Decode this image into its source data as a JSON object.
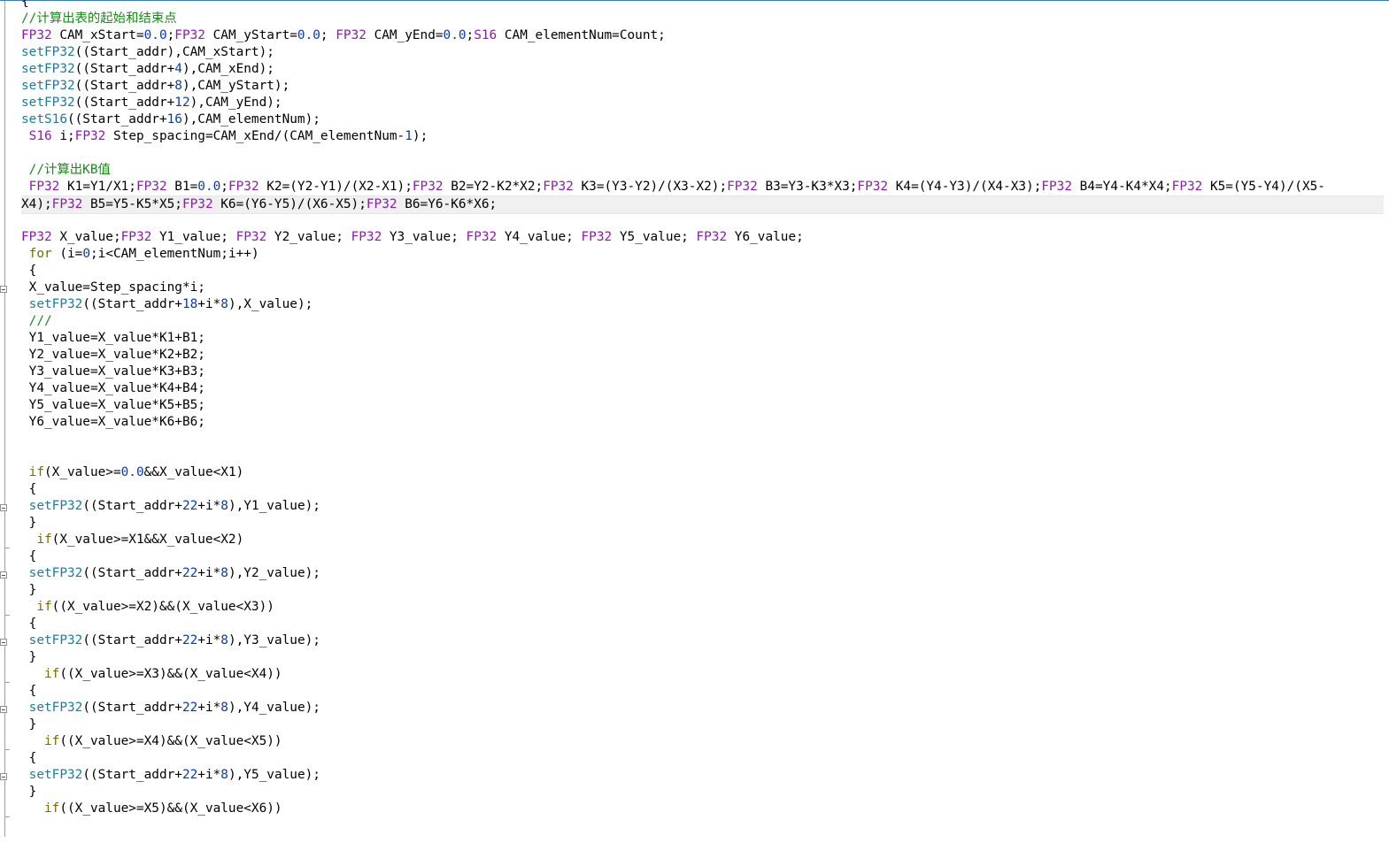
{
  "colors": {
    "type_keyword": "#8a1ea8",
    "function": "#1f7a9c",
    "number": "#0b3aa8",
    "comment": "#1a8a1a",
    "control": "#7a6a00",
    "text": "#000000",
    "current_line": "#f0f0f0"
  },
  "code_lines": [
    {
      "tokens": [
        {
          "t": "plain",
          "v": "{"
        }
      ]
    },
    {
      "tokens": [
        {
          "t": "cm",
          "v": "//计算出表的起始和结束点"
        }
      ]
    },
    {
      "tokens": [
        {
          "t": "kw",
          "v": "FP32"
        },
        {
          "t": "plain",
          "v": " CAM_xStart="
        },
        {
          "t": "num",
          "v": "0.0"
        },
        {
          "t": "plain",
          "v": ";"
        },
        {
          "t": "kw",
          "v": "FP32"
        },
        {
          "t": "plain",
          "v": " CAM_yStart="
        },
        {
          "t": "num",
          "v": "0.0"
        },
        {
          "t": "plain",
          "v": "; "
        },
        {
          "t": "kw",
          "v": "FP32"
        },
        {
          "t": "plain",
          "v": " CAM_yEnd="
        },
        {
          "t": "num",
          "v": "0.0"
        },
        {
          "t": "plain",
          "v": ";"
        },
        {
          "t": "kw",
          "v": "S16"
        },
        {
          "t": "plain",
          "v": " CAM_elementNum=Count;"
        }
      ]
    },
    {
      "tokens": [
        {
          "t": "fn",
          "v": "setFP32"
        },
        {
          "t": "plain",
          "v": "((Start_addr),CAM_xStart);"
        }
      ]
    },
    {
      "tokens": [
        {
          "t": "fn",
          "v": "setFP32"
        },
        {
          "t": "plain",
          "v": "((Start_addr+"
        },
        {
          "t": "num",
          "v": "4"
        },
        {
          "t": "plain",
          "v": "),CAM_xEnd);"
        }
      ]
    },
    {
      "tokens": [
        {
          "t": "fn",
          "v": "setFP32"
        },
        {
          "t": "plain",
          "v": "((Start_addr+"
        },
        {
          "t": "num",
          "v": "8"
        },
        {
          "t": "plain",
          "v": "),CAM_yStart);"
        }
      ]
    },
    {
      "tokens": [
        {
          "t": "fn",
          "v": "setFP32"
        },
        {
          "t": "plain",
          "v": "((Start_addr+"
        },
        {
          "t": "num",
          "v": "12"
        },
        {
          "t": "plain",
          "v": "),CAM_yEnd);"
        }
      ]
    },
    {
      "tokens": [
        {
          "t": "fn",
          "v": "setS16"
        },
        {
          "t": "plain",
          "v": "((Start_addr+"
        },
        {
          "t": "num",
          "v": "16"
        },
        {
          "t": "plain",
          "v": "),CAM_elementNum);"
        }
      ]
    },
    {
      "tokens": [
        {
          "t": "plain",
          "v": " "
        },
        {
          "t": "kw",
          "v": "S16"
        },
        {
          "t": "plain",
          "v": " i;"
        },
        {
          "t": "kw",
          "v": "FP32"
        },
        {
          "t": "plain",
          "v": " Step_spacing=CAM_xEnd/(CAM_elementNum-"
        },
        {
          "t": "num",
          "v": "1"
        },
        {
          "t": "plain",
          "v": ");"
        }
      ]
    },
    {
      "tokens": []
    },
    {
      "tokens": [
        {
          "t": "plain",
          "v": " "
        },
        {
          "t": "cm",
          "v": "//计算出KB值"
        }
      ]
    },
    {
      "tokens": [
        {
          "t": "plain",
          "v": " "
        },
        {
          "t": "kw",
          "v": "FP32"
        },
        {
          "t": "plain",
          "v": " K1=Y1/X1;"
        },
        {
          "t": "kw",
          "v": "FP32"
        },
        {
          "t": "plain",
          "v": " B1="
        },
        {
          "t": "num",
          "v": "0.0"
        },
        {
          "t": "plain",
          "v": ";"
        },
        {
          "t": "kw",
          "v": "FP32"
        },
        {
          "t": "plain",
          "v": " K2=(Y2-Y1)/(X2-X1);"
        },
        {
          "t": "kw",
          "v": "FP32"
        },
        {
          "t": "plain",
          "v": " B2=Y2-K2*X2;"
        },
        {
          "t": "kw",
          "v": "FP32"
        },
        {
          "t": "plain",
          "v": " K3=(Y3-Y2)/(X3-X2);"
        },
        {
          "t": "kw",
          "v": "FP32"
        },
        {
          "t": "plain",
          "v": " B3=Y3-K3*X3;"
        },
        {
          "t": "kw",
          "v": "FP32"
        },
        {
          "t": "plain",
          "v": " K4=(Y4-Y3)/(X4-X3);"
        },
        {
          "t": "kw",
          "v": "FP32"
        },
        {
          "t": "plain",
          "v": " B4=Y4-K4*X4;"
        },
        {
          "t": "kw",
          "v": "FP32"
        },
        {
          "t": "plain",
          "v": " K5=(Y5-Y4)/(X5-"
        }
      ]
    },
    {
      "highlight": true,
      "tokens": [
        {
          "t": "plain",
          "v": "X4);"
        },
        {
          "t": "kw",
          "v": "FP32"
        },
        {
          "t": "plain",
          "v": " B5=Y5-K5*X5;"
        },
        {
          "t": "kw",
          "v": "FP32"
        },
        {
          "t": "plain",
          "v": " K6=(Y6-Y5)/(X6-X5);"
        },
        {
          "t": "kw",
          "v": "FP32"
        },
        {
          "t": "plain",
          "v": " B6=Y6-K6*X6;"
        }
      ]
    },
    {
      "tokens": []
    },
    {
      "tokens": [
        {
          "t": "kw",
          "v": "FP32"
        },
        {
          "t": "plain",
          "v": " X_value;"
        },
        {
          "t": "kw",
          "v": "FP32"
        },
        {
          "t": "plain",
          "v": " Y1_value; "
        },
        {
          "t": "kw",
          "v": "FP32"
        },
        {
          "t": "plain",
          "v": " Y2_value; "
        },
        {
          "t": "kw",
          "v": "FP32"
        },
        {
          "t": "plain",
          "v": " Y3_value; "
        },
        {
          "t": "kw",
          "v": "FP32"
        },
        {
          "t": "plain",
          "v": " Y4_value; "
        },
        {
          "t": "kw",
          "v": "FP32"
        },
        {
          "t": "plain",
          "v": " Y5_value; "
        },
        {
          "t": "kw",
          "v": "FP32"
        },
        {
          "t": "plain",
          "v": " Y6_value;"
        }
      ]
    },
    {
      "tokens": [
        {
          "t": "plain",
          "v": " "
        },
        {
          "t": "ctl",
          "v": "for"
        },
        {
          "t": "plain",
          "v": " (i="
        },
        {
          "t": "num",
          "v": "0"
        },
        {
          "t": "plain",
          "v": ";i<CAM_elementNum;i++)"
        }
      ]
    },
    {
      "tokens": [
        {
          "t": "plain",
          "v": " {"
        }
      ]
    },
    {
      "tokens": [
        {
          "t": "plain",
          "v": " X_value=Step_spacing*i;"
        }
      ]
    },
    {
      "tokens": [
        {
          "t": "plain",
          "v": " "
        },
        {
          "t": "fn",
          "v": "setFP32"
        },
        {
          "t": "plain",
          "v": "((Start_addr+"
        },
        {
          "t": "num",
          "v": "18"
        },
        {
          "t": "plain",
          "v": "+i*"
        },
        {
          "t": "num",
          "v": "8"
        },
        {
          "t": "plain",
          "v": "),X_value);"
        }
      ]
    },
    {
      "tokens": [
        {
          "t": "plain",
          "v": " "
        },
        {
          "t": "cm",
          "v": "///"
        }
      ]
    },
    {
      "tokens": [
        {
          "t": "plain",
          "v": " Y1_value=X_value*K1+B1;"
        }
      ]
    },
    {
      "tokens": [
        {
          "t": "plain",
          "v": " Y2_value=X_value*K2+B2;"
        }
      ]
    },
    {
      "tokens": [
        {
          "t": "plain",
          "v": " Y3_value=X_value*K3+B3;"
        }
      ]
    },
    {
      "tokens": [
        {
          "t": "plain",
          "v": " Y4_value=X_value*K4+B4;"
        }
      ]
    },
    {
      "tokens": [
        {
          "t": "plain",
          "v": " Y5_value=X_value*K5+B5;"
        }
      ]
    },
    {
      "tokens": [
        {
          "t": "plain",
          "v": " Y6_value=X_value*K6+B6;"
        }
      ]
    },
    {
      "tokens": []
    },
    {
      "tokens": []
    },
    {
      "tokens": [
        {
          "t": "plain",
          "v": " "
        },
        {
          "t": "ctl",
          "v": "if"
        },
        {
          "t": "plain",
          "v": "(X_value>="
        },
        {
          "t": "num",
          "v": "0.0"
        },
        {
          "t": "plain",
          "v": "&&X_value<X1)"
        }
      ]
    },
    {
      "tokens": [
        {
          "t": "plain",
          "v": " {"
        }
      ]
    },
    {
      "tokens": [
        {
          "t": "plain",
          "v": " "
        },
        {
          "t": "fn",
          "v": "setFP32"
        },
        {
          "t": "plain",
          "v": "((Start_addr+"
        },
        {
          "t": "num",
          "v": "22"
        },
        {
          "t": "plain",
          "v": "+i*"
        },
        {
          "t": "num",
          "v": "8"
        },
        {
          "t": "plain",
          "v": "),Y1_value);"
        }
      ]
    },
    {
      "tokens": [
        {
          "t": "plain",
          "v": " }"
        }
      ]
    },
    {
      "tokens": [
        {
          "t": "plain",
          "v": "  "
        },
        {
          "t": "ctl",
          "v": "if"
        },
        {
          "t": "plain",
          "v": "(X_value>=X1&&X_value<X2)"
        }
      ]
    },
    {
      "tokens": [
        {
          "t": "plain",
          "v": " {"
        }
      ]
    },
    {
      "tokens": [
        {
          "t": "plain",
          "v": " "
        },
        {
          "t": "fn",
          "v": "setFP32"
        },
        {
          "t": "plain",
          "v": "((Start_addr+"
        },
        {
          "t": "num",
          "v": "22"
        },
        {
          "t": "plain",
          "v": "+i*"
        },
        {
          "t": "num",
          "v": "8"
        },
        {
          "t": "plain",
          "v": "),Y2_value);"
        }
      ]
    },
    {
      "tokens": [
        {
          "t": "plain",
          "v": " }"
        }
      ]
    },
    {
      "tokens": [
        {
          "t": "plain",
          "v": "  "
        },
        {
          "t": "ctl",
          "v": "if"
        },
        {
          "t": "plain",
          "v": "((X_value>=X2)&&(X_value<X3))"
        }
      ]
    },
    {
      "tokens": [
        {
          "t": "plain",
          "v": " {"
        }
      ]
    },
    {
      "tokens": [
        {
          "t": "plain",
          "v": " "
        },
        {
          "t": "fn",
          "v": "setFP32"
        },
        {
          "t": "plain",
          "v": "((Start_addr+"
        },
        {
          "t": "num",
          "v": "22"
        },
        {
          "t": "plain",
          "v": "+i*"
        },
        {
          "t": "num",
          "v": "8"
        },
        {
          "t": "plain",
          "v": "),Y3_value);"
        }
      ]
    },
    {
      "tokens": [
        {
          "t": "plain",
          "v": " }"
        }
      ]
    },
    {
      "tokens": [
        {
          "t": "plain",
          "v": "   "
        },
        {
          "t": "ctl",
          "v": "if"
        },
        {
          "t": "plain",
          "v": "((X_value>=X3)&&(X_value<X4))"
        }
      ]
    },
    {
      "tokens": [
        {
          "t": "plain",
          "v": " {"
        }
      ]
    },
    {
      "tokens": [
        {
          "t": "plain",
          "v": " "
        },
        {
          "t": "fn",
          "v": "setFP32"
        },
        {
          "t": "plain",
          "v": "((Start_addr+"
        },
        {
          "t": "num",
          "v": "22"
        },
        {
          "t": "plain",
          "v": "+i*"
        },
        {
          "t": "num",
          "v": "8"
        },
        {
          "t": "plain",
          "v": "),Y4_value);"
        }
      ]
    },
    {
      "tokens": [
        {
          "t": "plain",
          "v": " }"
        }
      ]
    },
    {
      "tokens": [
        {
          "t": "plain",
          "v": "   "
        },
        {
          "t": "ctl",
          "v": "if"
        },
        {
          "t": "plain",
          "v": "((X_value>=X4)&&(X_value<X5))"
        }
      ]
    },
    {
      "tokens": [
        {
          "t": "plain",
          "v": " {"
        }
      ]
    },
    {
      "tokens": [
        {
          "t": "plain",
          "v": " "
        },
        {
          "t": "fn",
          "v": "setFP32"
        },
        {
          "t": "plain",
          "v": "((Start_addr+"
        },
        {
          "t": "num",
          "v": "22"
        },
        {
          "t": "plain",
          "v": "+i*"
        },
        {
          "t": "num",
          "v": "8"
        },
        {
          "t": "plain",
          "v": "),Y5_value);"
        }
      ]
    },
    {
      "tokens": [
        {
          "t": "plain",
          "v": " }"
        }
      ]
    },
    {
      "tokens": [
        {
          "t": "plain",
          "v": "   "
        },
        {
          "t": "ctl",
          "v": "if"
        },
        {
          "t": "plain",
          "v": "((X_value>=X5)&&(X_value<X6))"
        }
      ]
    }
  ]
}
